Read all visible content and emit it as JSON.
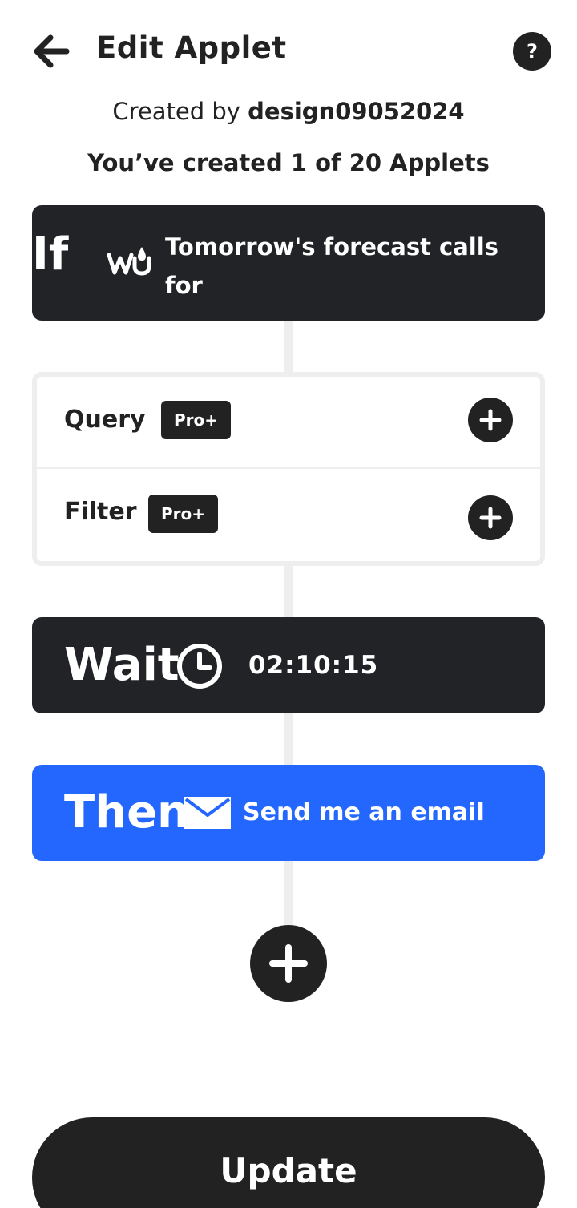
{
  "header": {
    "title": "Edit Applet",
    "back_icon": "arrow-left-icon",
    "help_icon": "help-icon",
    "help_label": "?"
  },
  "meta": {
    "created_by_prefix": "Created by",
    "created_by_user": "design09052024",
    "applet_count": "You’ve created 1 of 20 Applets"
  },
  "trigger": {
    "keyword": "If",
    "service_icon": "weather-underground-icon",
    "text": "Tomorrow's forecast calls for"
  },
  "options": [
    {
      "label": "Query",
      "badge": "Pro+"
    },
    {
      "label": "Filter",
      "badge": "Pro+"
    }
  ],
  "wait": {
    "keyword": "Wait",
    "icon": "clock-icon",
    "time": "02:10:15"
  },
  "action": {
    "keyword": "Then",
    "service_icon": "email-icon",
    "text": "Send me an email"
  },
  "update_label": "Update",
  "colors": {
    "dark_card": "#222326",
    "action_blue": "#2367ff",
    "connector": "#eeeeee",
    "text": "#222222"
  }
}
